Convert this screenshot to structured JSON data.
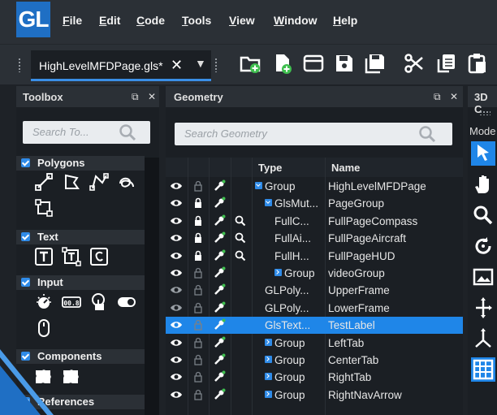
{
  "app": {
    "logo": "GL"
  },
  "menu": [
    {
      "label": "File",
      "underline": "F"
    },
    {
      "label": "Edit",
      "underline": "E"
    },
    {
      "label": "Code",
      "underline": "C"
    },
    {
      "label": "Tools",
      "underline": "T"
    },
    {
      "label": "View",
      "underline": "V"
    },
    {
      "label": "Window",
      "underline": "W"
    },
    {
      "label": "Help",
      "underline": "H"
    }
  ],
  "document_tab": {
    "label": "HighLevelMFDPage.gls*"
  },
  "toolbar": {
    "icons": [
      "new-folder-icon",
      "new-file-icon",
      "open-icon",
      "save-icon",
      "save-all-icon",
      "cut-icon",
      "copy-icon",
      "paste-icon"
    ]
  },
  "toolbox": {
    "title": "Toolbox",
    "search_placeholder": "Search To...",
    "categories": [
      {
        "label": "Polygons",
        "tools": [
          "line-tool-icon",
          "polygon-tool-icon",
          "polyline-tool-icon",
          "spline-tool-icon",
          "rectangle-tool-icon"
        ]
      },
      {
        "label": "Text",
        "tools": [
          "text-tool-icon",
          "text-box-tool-icon",
          "font-text-tool-icon"
        ]
      },
      {
        "label": "Input",
        "tools": [
          "knob-tool-icon",
          "digital-counter-icon",
          "touch-tool-icon",
          "toggle-tool-icon",
          "mouse-tool-icon"
        ]
      },
      {
        "label": "Components",
        "tools": [
          "component-tool-icon",
          "component-alt-tool-icon"
        ]
      },
      {
        "label": "References",
        "tools": []
      }
    ]
  },
  "geometry": {
    "title": "Geometry",
    "search_placeholder": "Search Geometry",
    "columns": {
      "type": "Type",
      "name": "Name"
    },
    "rows": [
      {
        "type": "Group",
        "name": "HighLevelMFDPage",
        "indent": 0,
        "expander": "open",
        "locked": false,
        "search": false,
        "dim": false,
        "selected": false
      },
      {
        "type": "GlsMut...",
        "name": "PageGroup",
        "indent": 1,
        "expander": "open",
        "locked": true,
        "search": false,
        "dim": false,
        "selected": false
      },
      {
        "type": "FullC...",
        "name": "FullPageCompass",
        "indent": 2,
        "expander": "none",
        "locked": true,
        "search": true,
        "dim": false,
        "selected": false
      },
      {
        "type": "FullAi...",
        "name": "FullPageAircraft",
        "indent": 2,
        "expander": "none",
        "locked": true,
        "search": true,
        "dim": false,
        "selected": false
      },
      {
        "type": "FullH...",
        "name": "FullPageHUD",
        "indent": 2,
        "expander": "none",
        "locked": true,
        "search": true,
        "dim": false,
        "selected": false
      },
      {
        "type": "Group",
        "name": "videoGroup",
        "indent": 2,
        "expander": "closed",
        "locked": false,
        "search": false,
        "dim": false,
        "selected": false
      },
      {
        "type": "GLPoly...",
        "name": "UpperFrame",
        "indent": 1,
        "expander": "none",
        "locked": false,
        "search": false,
        "dim": true,
        "selected": false
      },
      {
        "type": "GLPoly...",
        "name": "LowerFrame",
        "indent": 1,
        "expander": "none",
        "locked": false,
        "search": false,
        "dim": true,
        "selected": false
      },
      {
        "type": "GlsText...",
        "name": "TestLabel",
        "indent": 1,
        "expander": "none",
        "locked": false,
        "search": false,
        "dim": false,
        "selected": true
      },
      {
        "type": "Group",
        "name": "LeftTab",
        "indent": 1,
        "expander": "closed",
        "locked": false,
        "search": false,
        "dim": false,
        "selected": false
      },
      {
        "type": "Group",
        "name": "CenterTab",
        "indent": 1,
        "expander": "closed",
        "locked": false,
        "search": false,
        "dim": false,
        "selected": false
      },
      {
        "type": "Group",
        "name": "RightTab",
        "indent": 1,
        "expander": "closed",
        "locked": false,
        "search": false,
        "dim": false,
        "selected": false
      },
      {
        "type": "Group",
        "name": "RightNavArrow",
        "indent": 1,
        "expander": "closed",
        "locked": false,
        "search": false,
        "dim": false,
        "selected": false
      }
    ]
  },
  "panel3d": {
    "title": "3D C",
    "mode_label": "Mode",
    "tools": [
      "select-arrow-icon",
      "hand-pan-icon",
      "zoom-icon",
      "rotate-icon",
      "image-icon",
      "move-axes-icon",
      "axes-icon",
      "grid-icon"
    ]
  },
  "colors": {
    "accent": "#1f86e8",
    "panel_bg": "#1b1f24",
    "chrome_bg": "#2b3036"
  }
}
